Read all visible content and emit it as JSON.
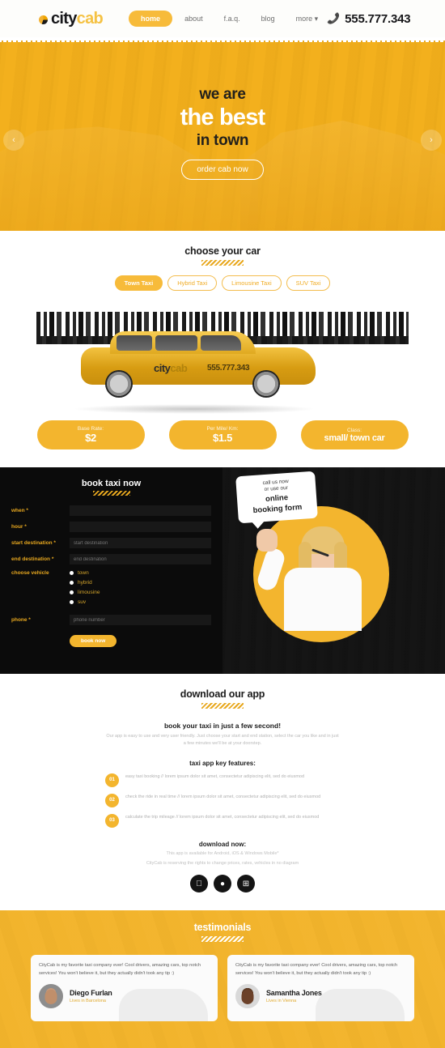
{
  "header": {
    "logo_mark": "pie-chart-icon",
    "logo_first": "city",
    "logo_second": "cab",
    "nav": [
      {
        "label": "home",
        "active": true
      },
      {
        "label": "about",
        "active": false
      },
      {
        "label": "f.a.q.",
        "active": false
      },
      {
        "label": "blog",
        "active": false
      },
      {
        "label": "more ▾",
        "active": false
      }
    ],
    "phone_icon": "phone-icon",
    "phone": "555.777.343"
  },
  "hero": {
    "line1": "we are",
    "line2": "the best",
    "line3": "in town",
    "cta": "order cab now",
    "prev": "‹",
    "next": "›"
  },
  "choose_car": {
    "title": "choose your car",
    "tabs": [
      {
        "label": "Town Taxi",
        "active": true
      },
      {
        "label": "Hybrid Taxi",
        "active": false
      },
      {
        "label": "Limousine Taxi",
        "active": false
      },
      {
        "label": "SUV Taxi",
        "active": false
      }
    ],
    "car_decal_first": "city",
    "car_decal_second": "cab",
    "car_phone": "555.777.343",
    "prices": [
      {
        "label": "Base Rate:",
        "value": "$2"
      },
      {
        "label": "Per Mile/ Km:",
        "value": "$1.5"
      },
      {
        "label": "Class:",
        "value": "small/ town car"
      }
    ]
  },
  "book": {
    "title": "book taxi now",
    "fields": [
      {
        "label": "when *",
        "placeholder": "",
        "value": ""
      },
      {
        "label": "hour *",
        "placeholder": "",
        "value": ""
      },
      {
        "label": "start destination *",
        "placeholder": "start destination",
        "value": ""
      },
      {
        "label": "end destination *",
        "placeholder": "end destination",
        "value": ""
      }
    ],
    "vehicle_label": "choose vehicle",
    "vehicles": [
      "town",
      "hybrid",
      "limousine",
      "suv"
    ],
    "phone_label": "phone *",
    "phone_placeholder": "phone number",
    "submit": "book now",
    "bubble_line1": "call us now",
    "bubble_line2": "or use our",
    "bubble_line3": "online",
    "bubble_line4": "booking form"
  },
  "app": {
    "title": "download our app",
    "subtitle": "book your taxi in just a few second!",
    "paragraph": "Our app is easy to use and very user friendly. Just choose your start and end station, select the car you like and in just a few minutes we'll be at your doorstep.",
    "features_title": "taxi app key features:",
    "features": [
      {
        "num": "01",
        "text": "easy taxi booking // lorem ipsum dolor sit amet, consectetur adipiscing elit, sed do eiusmod"
      },
      {
        "num": "02",
        "text": "check the ride in real time // lorem ipsum dolor sit amet, consectetur adipiscing elit, sed do eiusmod"
      },
      {
        "num": "03",
        "text": "calculate the trip mileage // lorem ipsum dolor sit amet, consectetur adipiscing elit, sed do eiusmod"
      }
    ],
    "download_title": "download now:",
    "download_note_1": "This app is available for Android, iOS & Windows Mobile*",
    "download_note_2": "CityCab is reserving the rights to change prices, rates, vehicles in no diagram",
    "stores": [
      {
        "icon": "apple-icon",
        "glyph": "စ"
      },
      {
        "icon": "android-icon",
        "glyph": "●"
      },
      {
        "icon": "windows-icon",
        "glyph": "⊞"
      }
    ]
  },
  "testimonials": {
    "title": "testimonials",
    "items": [
      {
        "quote": "CityCab is my favorite taxi company ever! Cool drivers, amazing cars, top notch services! You won't believe it, but they actually didn't took any tip :)",
        "name": "Diego Furlan",
        "location": "Lives in Barcelona"
      },
      {
        "quote": "CityCab is my favorite taxi company ever! Cool drivers, amazing cars, top notch services! You won't believe it, but they actually didn't took any tip :)",
        "name": "Samantha Jones",
        "location": "Lives in Vienna"
      }
    ]
  }
}
